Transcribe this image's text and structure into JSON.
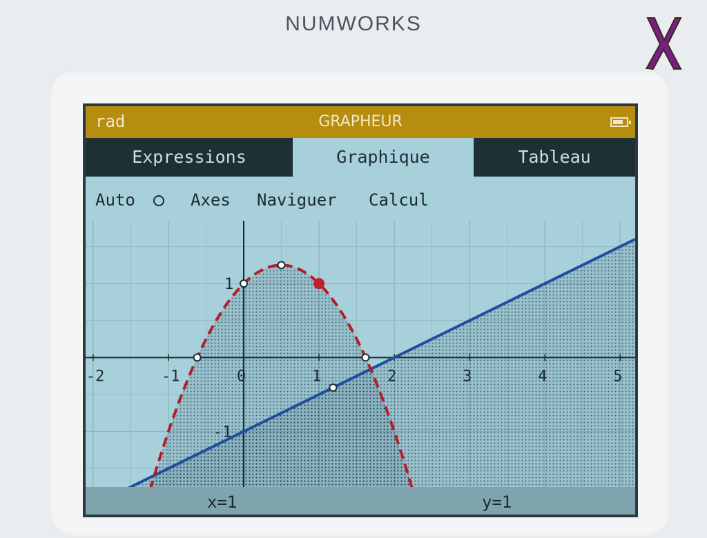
{
  "device": {
    "brand": "NUMWORKS",
    "logo_icon": "x-logo-icon"
  },
  "titlebar": {
    "angle_mode": "rad",
    "title": "GRAPHEUR",
    "battery_icon": "battery-icon"
  },
  "tabs": [
    {
      "label": "Expressions",
      "active": false
    },
    {
      "label": "Graphique",
      "active": true
    },
    {
      "label": "Tableau",
      "active": false
    }
  ],
  "toolbar": {
    "auto_label": "Auto",
    "auto_checked": false,
    "axes_label": "Axes",
    "navigate_label": "Naviguer",
    "calc_label": "Calcul"
  },
  "graph": {
    "x_ticks": [
      "-2",
      "-1",
      "0",
      "1",
      "2",
      "3",
      "4",
      "5"
    ],
    "y_ticks": [
      "1",
      "-1"
    ],
    "colors": {
      "background": "#a8d0da",
      "grid": "#8fb5bf",
      "axis": "#1a2a30",
      "line": "#1f4e9e",
      "parabola": "#b21e2a",
      "cursor": "#c0202a"
    }
  },
  "chart_data": {
    "type": "line",
    "xlim": [
      -2.1,
      5.2
    ],
    "ylim": [
      -1.75,
      1.85
    ],
    "grid": true,
    "series": [
      {
        "kind": "dashed-curve",
        "expression": "y=-x^2+x+1",
        "x_domain": [
          -1.3,
          2.3
        ],
        "shaded": true
      },
      {
        "kind": "solid-line",
        "expression": "y=0.5x-1",
        "x_domain": [
          -1.6,
          5.2
        ],
        "shaded": true
      }
    ],
    "cursor": {
      "x": 1,
      "y": 1
    }
  },
  "status": {
    "x_readout": "x=1",
    "y_readout": "y=1"
  }
}
